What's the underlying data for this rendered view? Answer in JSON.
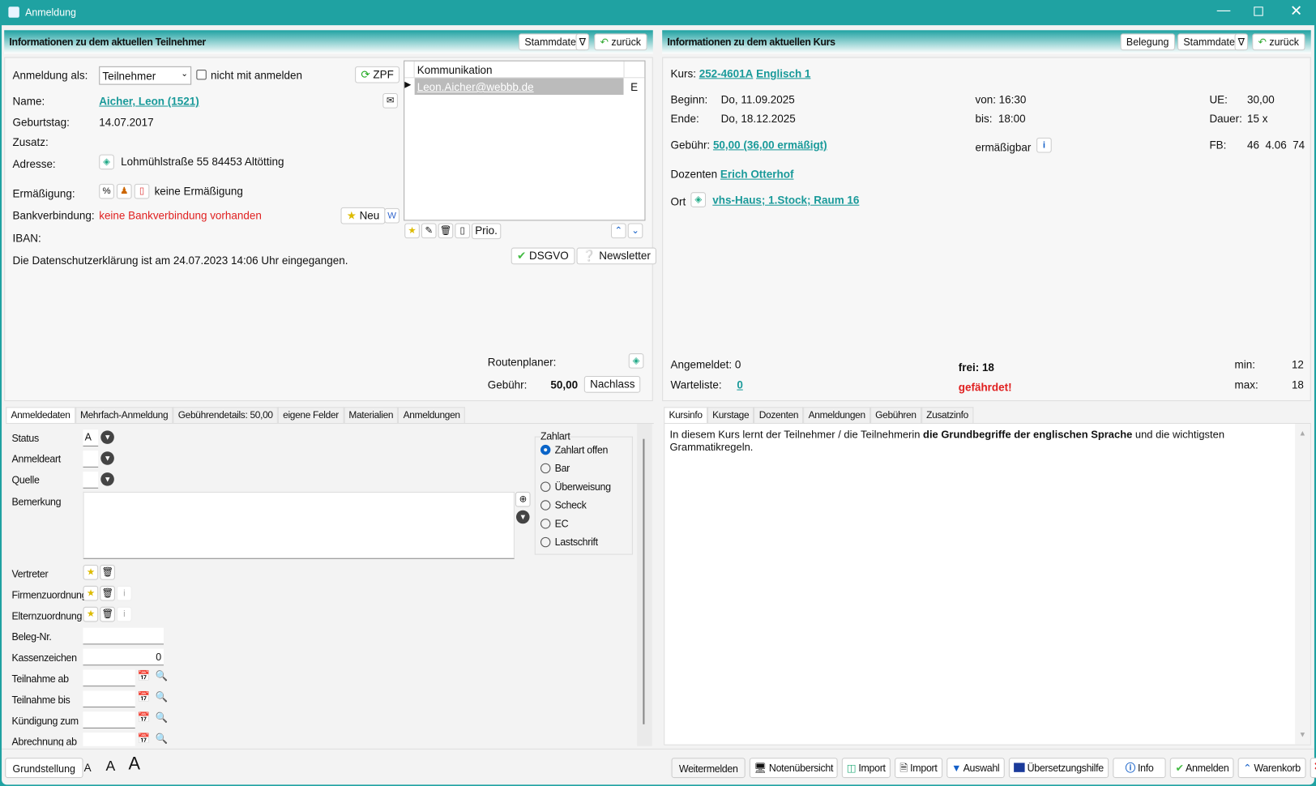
{
  "window": {
    "title": "Anmeldung"
  },
  "left": {
    "header": "Informationen zu dem aktuellen Teilnehmer",
    "stammdaten": "Stammdaten",
    "zurueck": "zurück",
    "anmeldung_als_label": "Anmeldung als:",
    "anmeldung_als_value": "Teilnehmer",
    "nicht_mit_anmelden": "nicht mit anmelden",
    "zpf": "ZPF",
    "name_label": "Name:",
    "name_value": "Aicher, Leon (1521)",
    "geburtstag_label": "Geburtstag:",
    "geburtstag_value": "14.07.2017",
    "zusatz_label": "Zusatz:",
    "adresse_label": "Adresse:",
    "adresse_value": "Lohmühlstraße 55 84453 Altötting",
    "ermaessigung_label": "Ermäßigung:",
    "ermaessigung_value": "keine Ermäßigung",
    "bank_label": "Bankverbindung:",
    "bank_value": "keine Bankverbindung vorhanden",
    "neu": "Neu",
    "iban_label": "IBAN:",
    "datenschutz": "Die Datenschutzerklärung ist am 24.07.2023 14:06 Uhr eingegangen.",
    "komm_header": "Kommunikation",
    "komm_col2": "E",
    "komm_rows": [
      {
        "value": "Leon.Aicher@webbb.de",
        "type": "E"
      }
    ],
    "prio": "Prio.",
    "dsgvo": "DSGVO",
    "newsletter": "Newsletter",
    "routenplaner": "Routenplaner:",
    "gebuehr_label": "Gebühr:",
    "gebuehr_value": "50,00",
    "nachlass": "Nachlass",
    "tabs": [
      "Anmeldedaten",
      "Mehrfach-Anmeldung",
      "Gebührendetails: 50,00",
      "eigene Felder",
      "Materialien",
      "Anmeldungen"
    ],
    "fields": {
      "status": "Status",
      "status_value": "A",
      "anmeldeart": "Anmeldeart",
      "quelle": "Quelle",
      "bemerkung": "Bemerkung",
      "vertreter": "Vertreter",
      "firmenzuordnung": "Firmenzuordnung",
      "elternzuordnung": "Elternzuordnung",
      "beleg": "Beleg-Nr.",
      "kassenzeichen": "Kassenzeichen",
      "kassenzeichen_value": "0",
      "teilnahme_ab": "Teilnahme ab",
      "teilnahme_bis": "Teilnahme bis",
      "kuendigung": "Kündigung zum",
      "abrechnung": "Abrechnung ab"
    },
    "zahlart": {
      "title": "Zahlart",
      "options": [
        "Zahlart offen",
        "Bar",
        "Überweisung",
        "Scheck",
        "EC",
        "Lastschrift"
      ],
      "selected": 0
    }
  },
  "right": {
    "header": "Informationen zu dem aktuellen Kurs",
    "belegung": "Belegung",
    "stammdaten": "Stammdaten",
    "zurueck": "zurück",
    "kurs_label": "Kurs:",
    "kurs_nr": "252-4601A",
    "kurs_name": "Englisch 1",
    "beginn_label": "Beginn:",
    "beginn": "Do, 11.09.2025",
    "ende_label": "Ende:",
    "ende": "Do, 18.12.2025",
    "von": "von: 16:30",
    "bis": "bis:  18:00",
    "ue_label": "UE:",
    "ue": "30,00",
    "dauer_label": "Dauer:",
    "dauer": "15 x",
    "gebuehr_label": "Gebühr:",
    "gebuehr": "50,00 (36,00 ermäßigt)",
    "ermaessigbar": "ermäßigbar",
    "fb_label": "FB:",
    "fb": "46  4.06  74",
    "dozenten_label": "Dozenten",
    "dozent": "Erich Otterhof",
    "ort_label": "Ort",
    "ort": "vhs-Haus; 1.Stock; Raum 16",
    "angemeldet": "Angemeldet: 0",
    "frei": "frei: 18",
    "min_label": "min:",
    "min": "12",
    "warteliste_label": "Warteliste:",
    "warteliste": "0",
    "gefaehrdet": "gefährdet!",
    "max_label": "max:",
    "max": "18",
    "tabs": [
      "Kursinfo",
      "Kurstage",
      "Dozenten",
      "Anmeldungen",
      "Gebühren",
      "Zusatzinfo"
    ],
    "info_pre": "In diesem Kurs lernt der Teilnehmer / die Teilnehmerin ",
    "info_bold": "die Grundbegriffe der englischen Sprache",
    "info_post": " und die wichtigsten Grammatikregeln."
  },
  "footer": {
    "grundstellung": "Grundstellung",
    "font_small": "A",
    "font_mid": "A",
    "font_large": "A",
    "buttons": [
      "Weitermelden",
      "Notenübersicht",
      "Import",
      "Import",
      "Auswahl",
      "Übersetzungshilfe",
      "Info",
      "Anmelden",
      "Warenkorb"
    ]
  }
}
